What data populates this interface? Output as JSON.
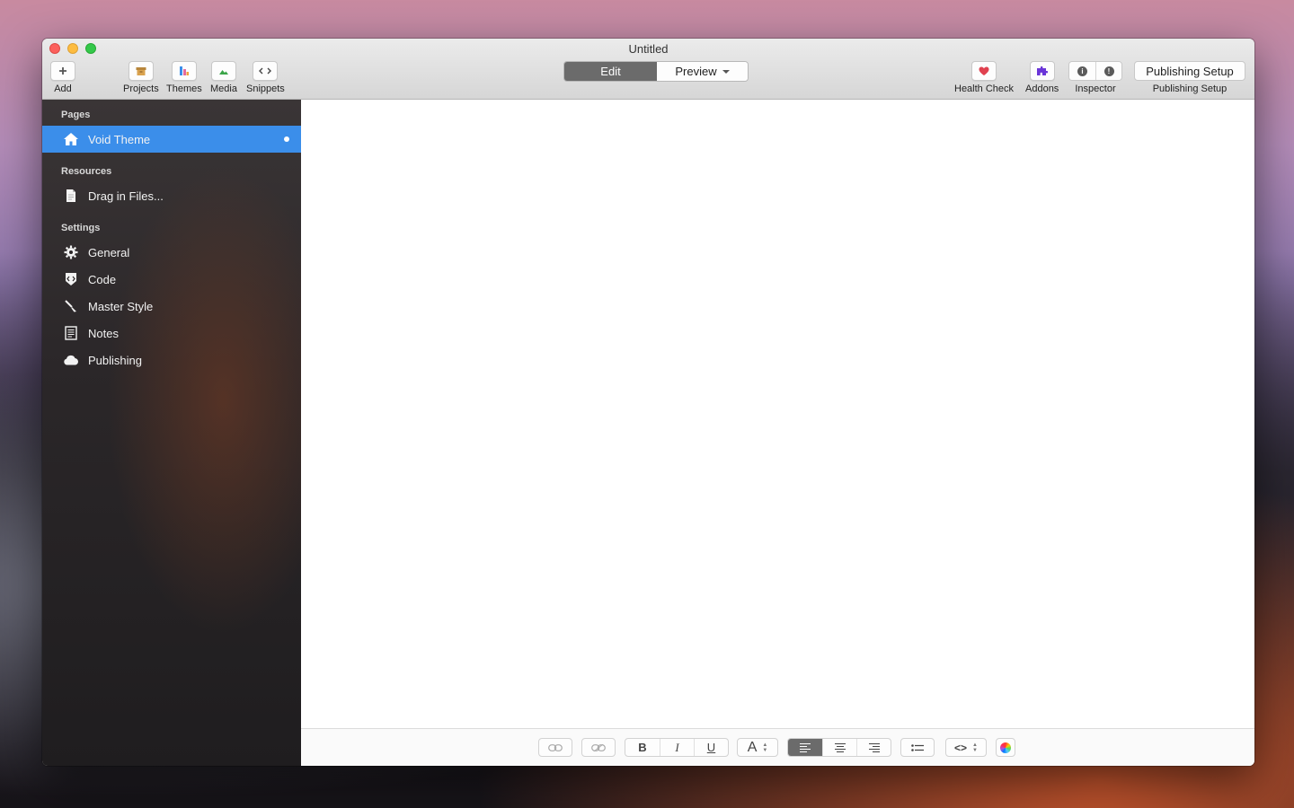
{
  "window": {
    "title": "Untitled"
  },
  "toolbar": {
    "left": [
      {
        "label": "Add",
        "icon": "plus-icon"
      },
      {
        "label": "Projects",
        "icon": "box-icon"
      },
      {
        "label": "Themes",
        "icon": "themes-icon"
      },
      {
        "label": "Media",
        "icon": "image-icon"
      },
      {
        "label": "Snippets",
        "icon": "code-icon"
      }
    ],
    "mode": {
      "edit": "Edit",
      "preview": "Preview",
      "active": "edit"
    },
    "right": [
      {
        "label": "Health Check",
        "icon": "heart-icon"
      },
      {
        "label": "Addons",
        "icon": "puzzle-icon"
      },
      {
        "label": "Inspector",
        "icon": "info-icon"
      },
      {
        "label": "Publishing Setup",
        "button": "Publishing Setup"
      }
    ]
  },
  "sidebar": {
    "pages_heading": "Pages",
    "pages": [
      {
        "label": "Void Theme",
        "icon": "home-icon",
        "selected": true
      }
    ],
    "resources_heading": "Resources",
    "resources": [
      {
        "label": "Drag in Files...",
        "icon": "file-icon"
      }
    ],
    "settings_heading": "Settings",
    "settings": [
      {
        "label": "General",
        "icon": "gear-icon"
      },
      {
        "label": "Code",
        "icon": "code-badge-icon"
      },
      {
        "label": "Master Style",
        "icon": "brush-icon"
      },
      {
        "label": "Notes",
        "icon": "notes-icon"
      },
      {
        "label": "Publishing",
        "icon": "cloud-icon"
      }
    ]
  },
  "format_bar": {
    "bold": "B",
    "italic": "I",
    "underline": "U",
    "font_size": "A",
    "code": "<>",
    "alignment": "left"
  },
  "colors": {
    "accent": "#3b8eea",
    "segment_active": "#6b6b6b"
  }
}
